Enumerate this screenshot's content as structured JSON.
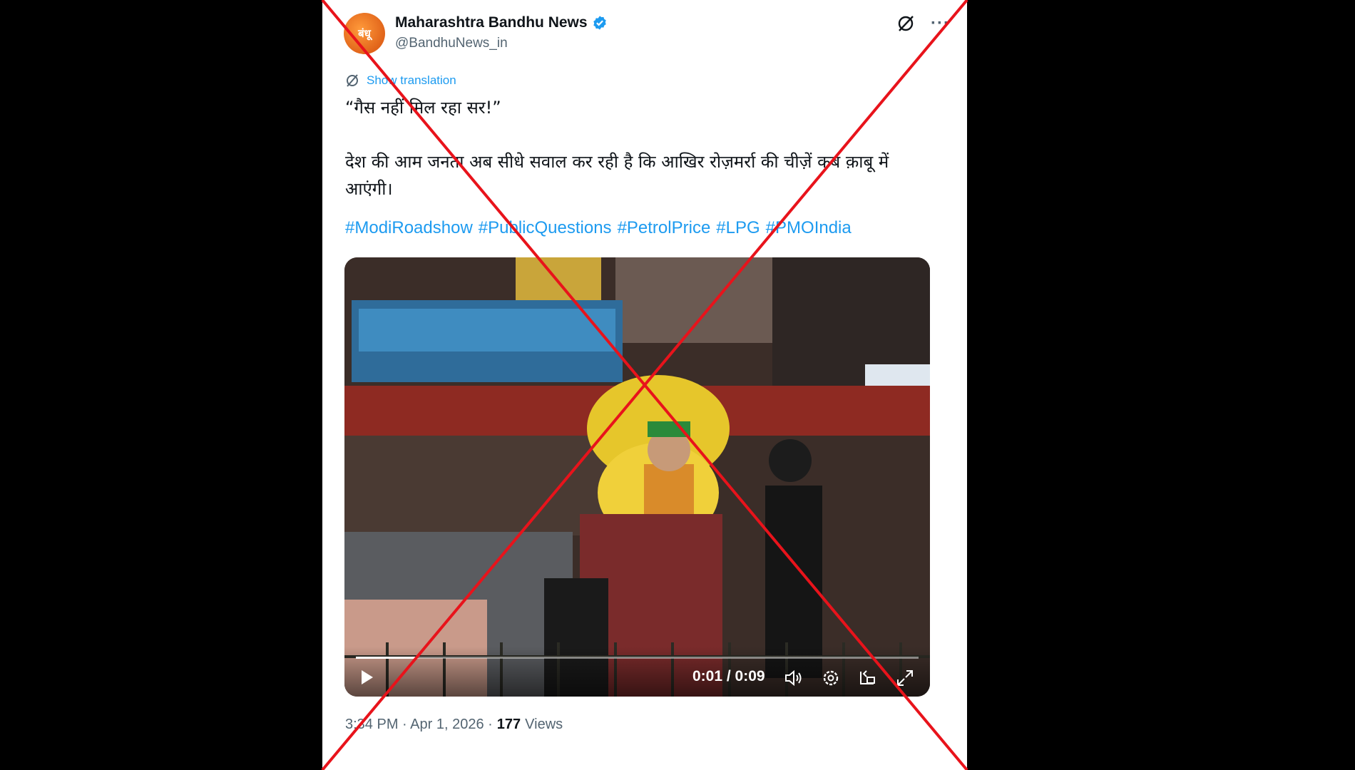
{
  "tweet": {
    "author": {
      "display_name": "Maharashtra Bandhu News",
      "handle": "@BandhuNews_in",
      "avatar_text": "बंधू",
      "verified": true
    },
    "header_icons": [
      "grok-icon",
      "more-icon"
    ],
    "more_label": "···",
    "translate_label": "Show translation",
    "text": "“गैस नहीं मिल रहा सर!”\n\nदेश की आम जनता अब सीधे सवाल कर रही है कि आखिर रोज़मर्रा की चीज़ें कब क़ाबू में आएंगी।",
    "hashtags": [
      "#ModiRoadshow",
      "#PublicQuestions",
      "#PetrolPrice",
      "#LPG",
      "#PMOIndia"
    ],
    "video": {
      "current_time": "0:01",
      "duration": "0:09",
      "timecode": "0:01 / 0:09",
      "progress": 0.11,
      "controls": [
        "play-icon",
        "volume-icon",
        "settings-icon",
        "pip-icon",
        "fullscreen-icon"
      ]
    },
    "timestamp": "3:34 PM · Apr 1, 2026 ·",
    "views_count": "177",
    "views_label": "Views"
  },
  "overlay": {
    "mark": "red-x-cross",
    "color": "#e8131b"
  },
  "colors": {
    "link": "#1d9bf0",
    "text": "#0f1419",
    "muted": "#536471",
    "verified": "#1d9bf0"
  }
}
